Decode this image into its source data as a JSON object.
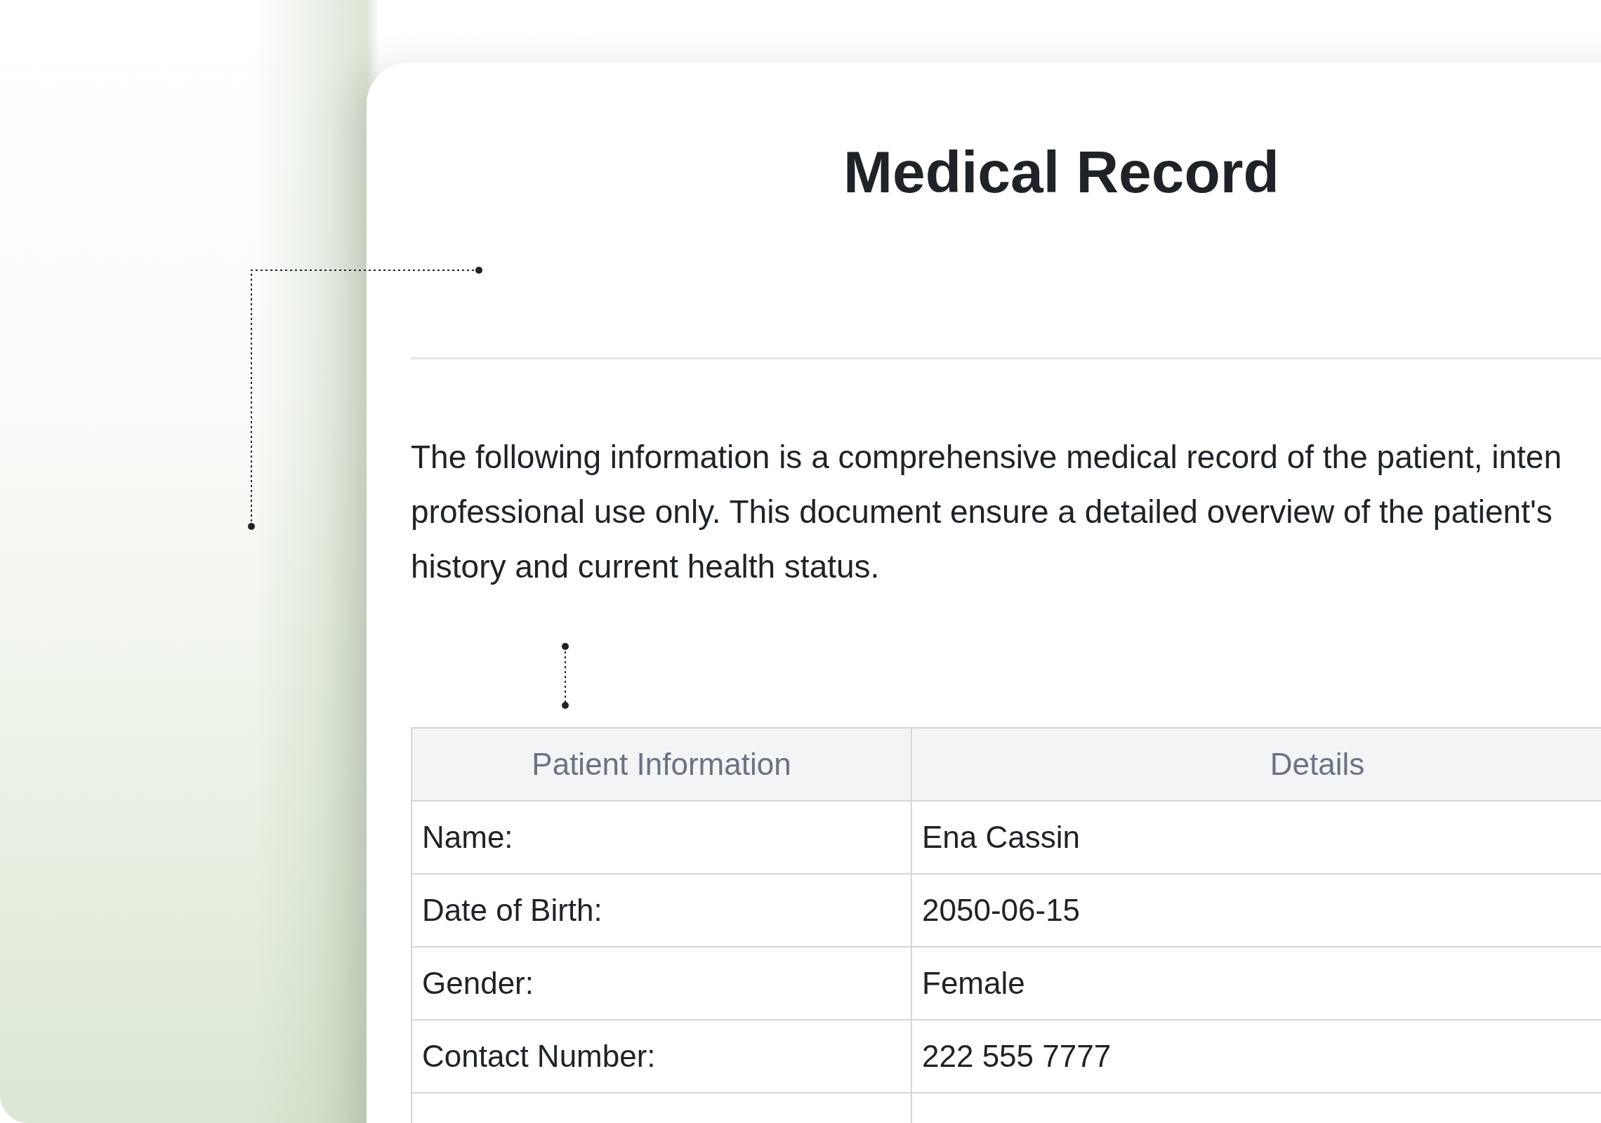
{
  "document": {
    "title": "Medical Record",
    "intro_lines": [
      "The following information is a comprehensive medical record of the patient, inten",
      "professional use only. This document ensure a detailed overview of the patient's",
      "history and current health status."
    ],
    "table": {
      "columns": [
        "Patient Information",
        "Details"
      ],
      "rows": [
        [
          "Name:",
          "Ena Cassin"
        ],
        [
          "Date of Birth:",
          "2050-06-15"
        ],
        [
          "Gender:",
          "Female"
        ],
        [
          "Contact Number:",
          "222 555 7777"
        ]
      ]
    }
  }
}
